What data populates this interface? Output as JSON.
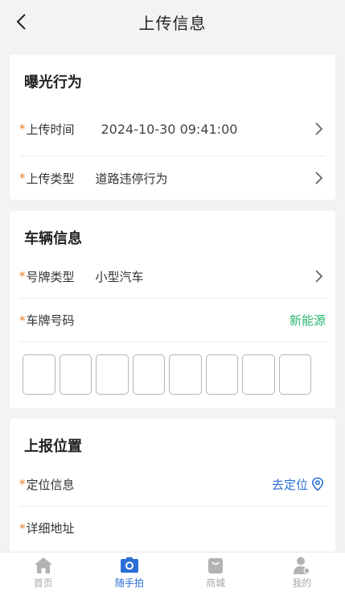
{
  "header": {
    "title": "上传信息"
  },
  "exposure": {
    "title": "曝光行为",
    "time_label": "上传时间",
    "time_value": "2024-10-30 09:41:00",
    "type_label": "上传类型",
    "type_value": "道路违停行为"
  },
  "vehicle": {
    "title": "车辆信息",
    "plate_type_label": "号牌类型",
    "plate_type_value": "小型汽车",
    "plate_number_label": "车牌号码",
    "new_energy_label": "新能源",
    "plate_chars": [
      "",
      "",
      "",
      "",
      "",
      "",
      "",
      ""
    ]
  },
  "location": {
    "title": "上报位置",
    "locate_label": "定位信息",
    "locate_action": "去定位",
    "address_label": "详细地址"
  },
  "tabbar": {
    "items": [
      {
        "label": "首页",
        "icon": "home-icon",
        "active": false
      },
      {
        "label": "随手拍",
        "icon": "camera-icon",
        "active": true
      },
      {
        "label": "商城",
        "icon": "shop-bag-icon",
        "active": false
      },
      {
        "label": "我的",
        "icon": "user-icon",
        "active": false
      }
    ]
  },
  "colors": {
    "accent": "#2b6fd6",
    "required_star": "#f07b1e",
    "new_energy": "#2bb673",
    "background": "#f2f3f5"
  }
}
